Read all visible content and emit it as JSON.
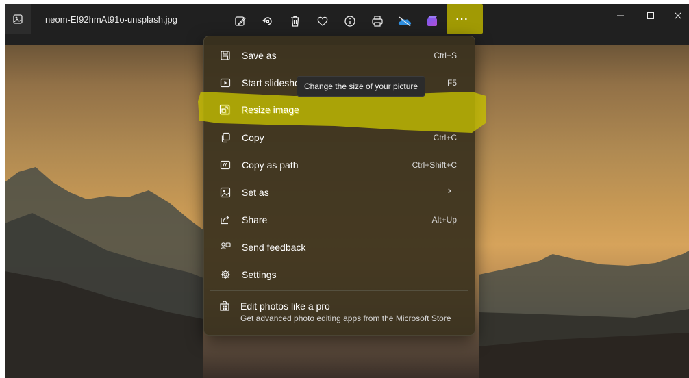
{
  "title_bar": {
    "file_name": "neom-EI92hmAt91o-unsplash.jpg",
    "app_icon": "image-icon"
  },
  "toolbar": {
    "buttons": [
      {
        "name": "edit-image-icon"
      },
      {
        "name": "rotate-icon"
      },
      {
        "name": "delete-icon"
      },
      {
        "name": "favorite-heart-icon"
      },
      {
        "name": "info-icon"
      },
      {
        "name": "print-icon"
      },
      {
        "name": "onedrive-icon"
      },
      {
        "name": "clipchamp-icon"
      }
    ],
    "more_label": "···"
  },
  "window_controls": [
    "minimize",
    "maximize",
    "close"
  ],
  "menu": {
    "items": [
      {
        "label": "Save as",
        "shortcut": "Ctrl+S",
        "icon": "save-icon"
      },
      {
        "label": "Start slideshow",
        "shortcut": "F5",
        "icon": "slideshow-icon"
      },
      {
        "label": "Resize image",
        "shortcut": "",
        "icon": "resize-icon"
      },
      {
        "label": "Copy",
        "shortcut": "Ctrl+C",
        "icon": "copy-icon"
      },
      {
        "label": "Copy as path",
        "shortcut": "Ctrl+Shift+C",
        "icon": "copy-path-icon"
      },
      {
        "label": "Set as",
        "shortcut": "",
        "icon": "set-as-icon",
        "submenu": true
      },
      {
        "label": "Share",
        "shortcut": "Alt+Up",
        "icon": "share-icon"
      },
      {
        "label": "Send feedback",
        "shortcut": "",
        "icon": "feedback-icon"
      },
      {
        "label": "Settings",
        "shortcut": "",
        "icon": "settings-icon"
      }
    ],
    "promo": {
      "title": "Edit photos like a pro",
      "subtitle": "Get advanced photo editing apps from the Microsoft Store",
      "icon": "store-icon"
    }
  },
  "tooltip": {
    "text": "Change the size of your picture"
  },
  "highlight_color": "#b8b000"
}
